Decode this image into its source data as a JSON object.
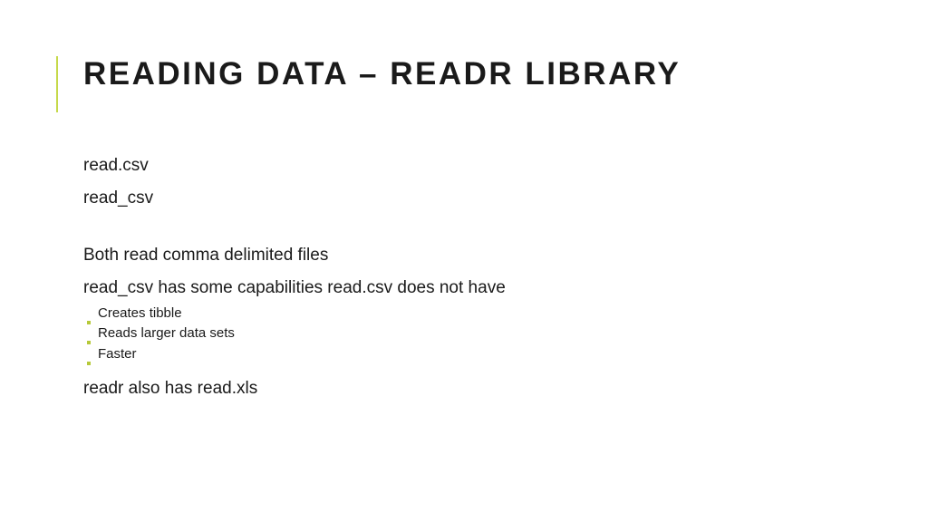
{
  "title": "READING DATA – READR LIBRARY",
  "body": {
    "line1": "read.csv",
    "line2": "read_csv",
    "line3": "Both read comma delimited files",
    "line4": "read_csv has some capabilities read.csv does not have",
    "sub": {
      "a": "Creates tibble",
      "b": "Reads larger data sets",
      "c": "Faster"
    },
    "line5": "readr also has read.xls"
  }
}
